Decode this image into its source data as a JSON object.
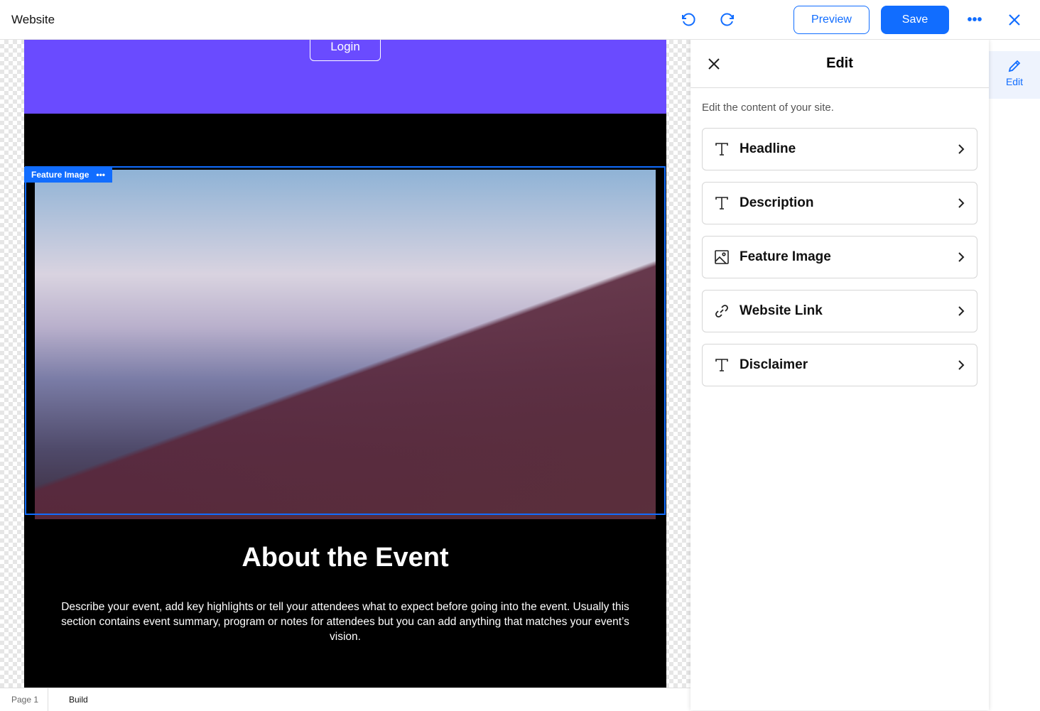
{
  "topbar": {
    "title": "Website",
    "preview": "Preview",
    "save": "Save"
  },
  "site": {
    "login": "Login",
    "selection_label": "Feature Image",
    "heading": "About the Event",
    "description": "Describe your event, add key highlights or tell your attendees what to expect before going into the event. Usually this section contains event summary, program or notes for attendees but you can add anything that matches your event’s vision."
  },
  "panel": {
    "title": "Edit",
    "subtitle": "Edit the content of your site.",
    "items": [
      {
        "label": "Headline",
        "icon": "text-icon"
      },
      {
        "label": "Description",
        "icon": "text-icon"
      },
      {
        "label": "Feature Image",
        "icon": "image-icon"
      },
      {
        "label": "Website Link",
        "icon": "link-icon"
      },
      {
        "label": "Disclaimer",
        "icon": "text-icon"
      }
    ]
  },
  "rail": {
    "edit": "Edit"
  },
  "bottombar": {
    "page": "Page 1",
    "mode": "Build"
  },
  "colors": {
    "accent": "#116dff",
    "hero": "#6a4bff"
  }
}
